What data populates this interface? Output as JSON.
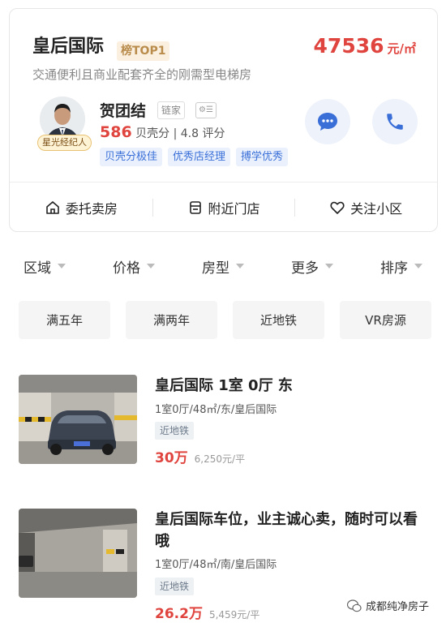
{
  "community": {
    "name": "皇后国际",
    "rank_badge": "榜TOP1",
    "price_num": "47536",
    "price_unit": "元/㎡",
    "tagline": "交通便利且商业配套齐全的刚需型电梯房"
  },
  "agent": {
    "name": "贺团结",
    "company": "链家",
    "level": "星光经纪人",
    "score": "586",
    "score_label": "贝壳分",
    "rating": "| 4.8 评分",
    "badges": [
      "贝壳分极佳",
      "优秀店经理",
      "搏学优秀"
    ]
  },
  "actions": [
    {
      "label": "委托卖房",
      "icon": "home-icon"
    },
    {
      "label": "附近门店",
      "icon": "store-icon"
    },
    {
      "label": "关注小区",
      "icon": "heart-icon"
    }
  ],
  "filters": [
    "区域",
    "价格",
    "房型",
    "更多",
    "排序"
  ],
  "quick_tags": [
    "满五年",
    "满两年",
    "近地铁",
    "VR房源"
  ],
  "listings": [
    {
      "title": "皇后国际 1室 0厅 东",
      "meta": "1室0厅/48㎡/东/皇后国际",
      "tag": "近地铁",
      "total": "30万",
      "unit_price": "6,250元/平"
    },
    {
      "title": "皇后国际车位，业主诚心卖，随时可以看哦",
      "meta": "1室0厅/48㎡/南/皇后国际",
      "tag": "近地铁",
      "total": "26.2万",
      "unit_price": "5,459元/平"
    }
  ],
  "watermark": "成都纯净房子",
  "colors": {
    "price_red": "#e0443e",
    "accent_blue": "#3a6fd8",
    "badge_gold": "#b98c4c"
  }
}
